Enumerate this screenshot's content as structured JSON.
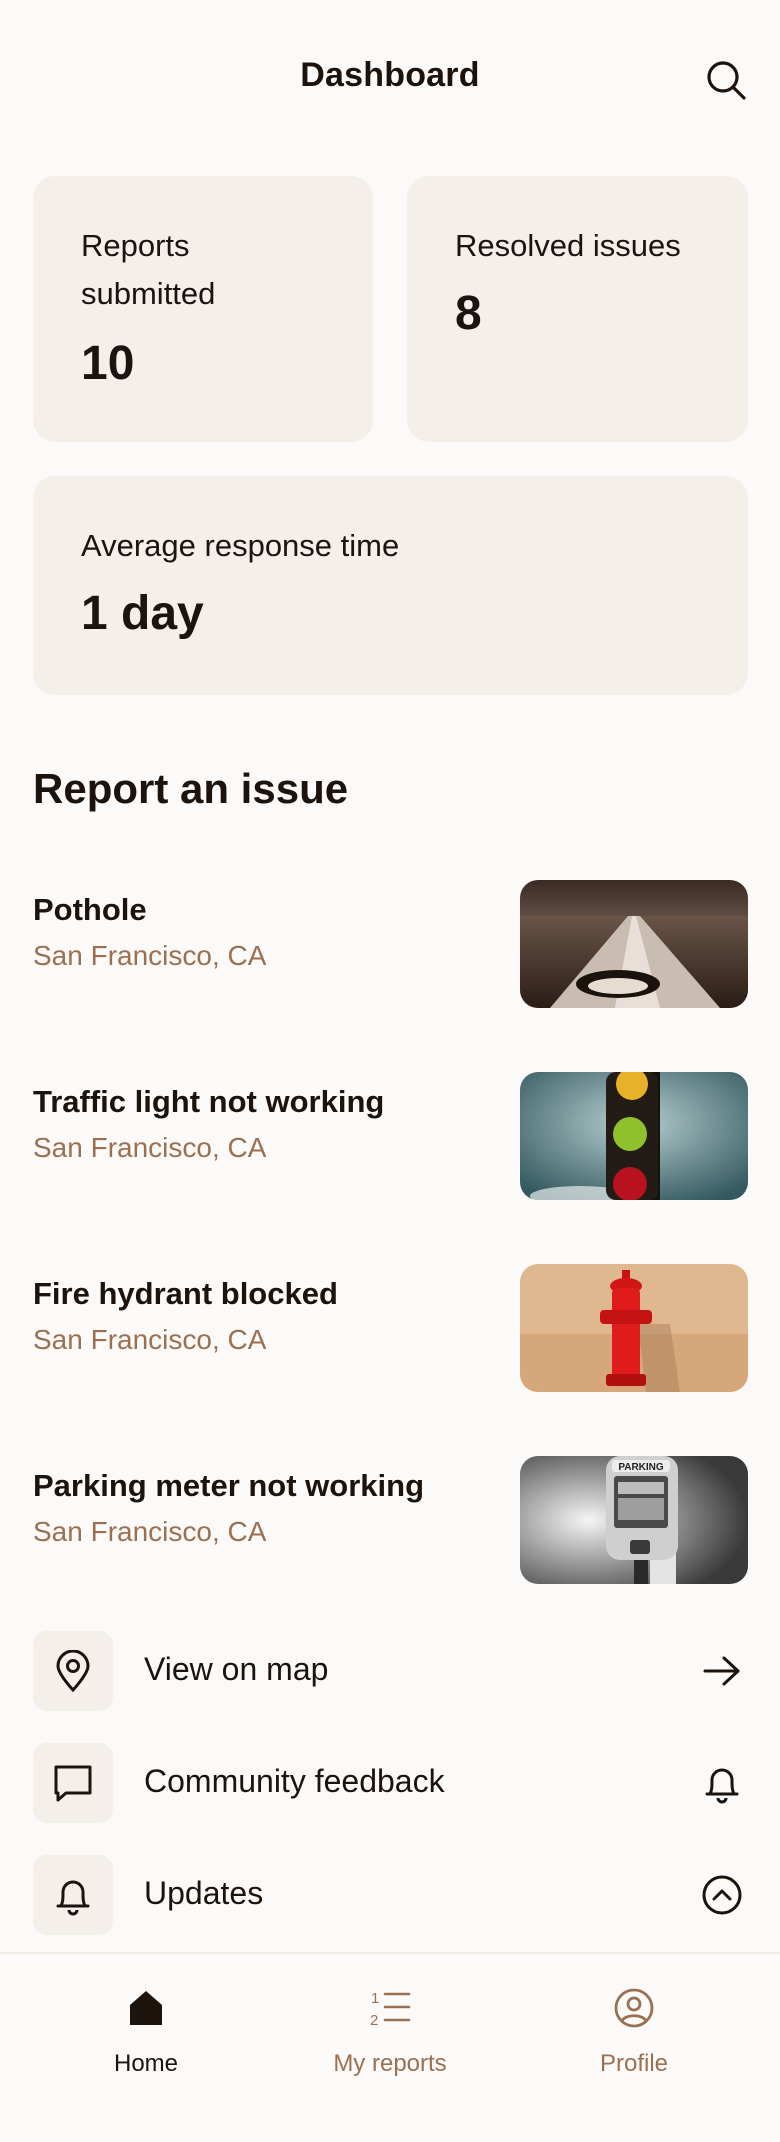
{
  "header": {
    "title": "Dashboard"
  },
  "stats": {
    "reports": {
      "label": "Reports submitted",
      "value": "10"
    },
    "resolved": {
      "label": "Resolved issues",
      "value": "8"
    },
    "response": {
      "label": "Average response time",
      "value": "1 day"
    }
  },
  "report_section": {
    "title": "Report an issue",
    "items": [
      {
        "title": "Pothole",
        "location": "San Francisco, CA"
      },
      {
        "title": "Traffic light not working",
        "location": "San Francisco, CA"
      },
      {
        "title": "Fire hydrant blocked",
        "location": "San Francisco, CA"
      },
      {
        "title": "Parking meter not working",
        "location": "San Francisco, CA"
      }
    ],
    "parking_sign_text": "PARKING"
  },
  "actions": [
    {
      "label": "View on map",
      "icon": "map-pin-icon",
      "trail_icon": "arrow-right-icon"
    },
    {
      "label": "Community feedback",
      "icon": "chat-icon",
      "trail_icon": "bell-icon"
    },
    {
      "label": "Updates",
      "icon": "bell-icon",
      "trail_icon": "chevron-up-circle-icon"
    }
  ],
  "nav": [
    {
      "label": "Home",
      "icon": "home-icon",
      "active": true
    },
    {
      "label": "My reports",
      "icon": "numbered-list-icon",
      "active": false
    },
    {
      "label": "Profile",
      "icon": "user-circle-icon",
      "active": false
    }
  ],
  "colors": {
    "background": "#fcfaf8",
    "card": "#f4efe9",
    "text": "#1c130d",
    "accent": "#9a7150"
  }
}
